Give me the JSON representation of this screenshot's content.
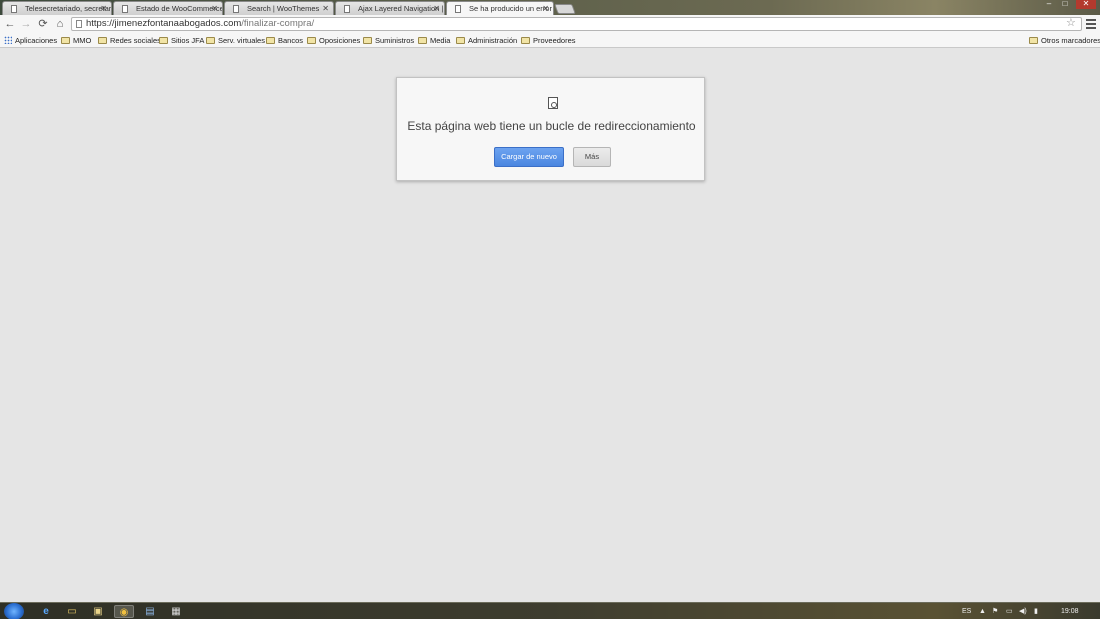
{
  "tabs": [
    {
      "label": "Telesecretariado, secretari",
      "active": false
    },
    {
      "label": "Estado de WooCommerce",
      "active": false
    },
    {
      "label": "Search | WooThemes",
      "active": false
    },
    {
      "label": "Ajax Layered Navigation |",
      "active": false
    },
    {
      "label": "Se ha producido un error",
      "active": true
    }
  ],
  "window_controls": {
    "minimize": "–",
    "maximize": "□",
    "close": "✕"
  },
  "toolbar": {
    "back_icon": "←",
    "forward_icon": "→",
    "reload_icon": "⟳",
    "home_icon": "⌂",
    "star_icon": "☆",
    "url_host": "https://jimenezfontanaabogados.com",
    "url_path": "/finalizar-compra/"
  },
  "bookmarks": {
    "apps": "Aplicaciones",
    "items": [
      "MMO",
      "Redes sociales",
      "Sitios JFA",
      "Serv. virtuales",
      "Bancos",
      "Oposiciones",
      "Suministros",
      "Media",
      "Administración",
      "Proveedores"
    ],
    "other": "Otros marcadores"
  },
  "error": {
    "title": "Esta página web tiene un bucle de redireccionamiento",
    "reload_label": "Cargar de nuevo",
    "more_label": "Más"
  },
  "taskbar": {
    "icons": [
      "e",
      "▭",
      "▣",
      "◉",
      "▤",
      "▦"
    ],
    "language": "ES",
    "tray_icons": [
      "▲",
      "⚑",
      "▭",
      "◀)",
      "▮"
    ],
    "time": "19:08"
  }
}
